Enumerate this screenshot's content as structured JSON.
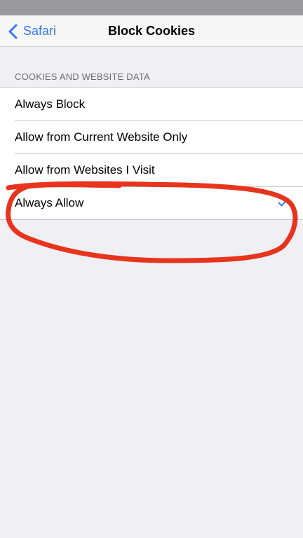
{
  "nav": {
    "back_label": "Safari",
    "title": "Block Cookies"
  },
  "section": {
    "header": "COOKIES AND WEBSITE DATA"
  },
  "options": [
    {
      "label": "Always Block",
      "selected": false
    },
    {
      "label": "Allow from Current Website Only",
      "selected": false
    },
    {
      "label": "Allow from Websites I Visit",
      "selected": false
    },
    {
      "label": "Always Allow",
      "selected": true
    }
  ],
  "colors": {
    "accent": "#3478f6",
    "background": "#efeff4",
    "annotation": "#e8341c"
  },
  "icons": {
    "back": "chevron-left-icon",
    "selected": "checkmark-icon"
  }
}
